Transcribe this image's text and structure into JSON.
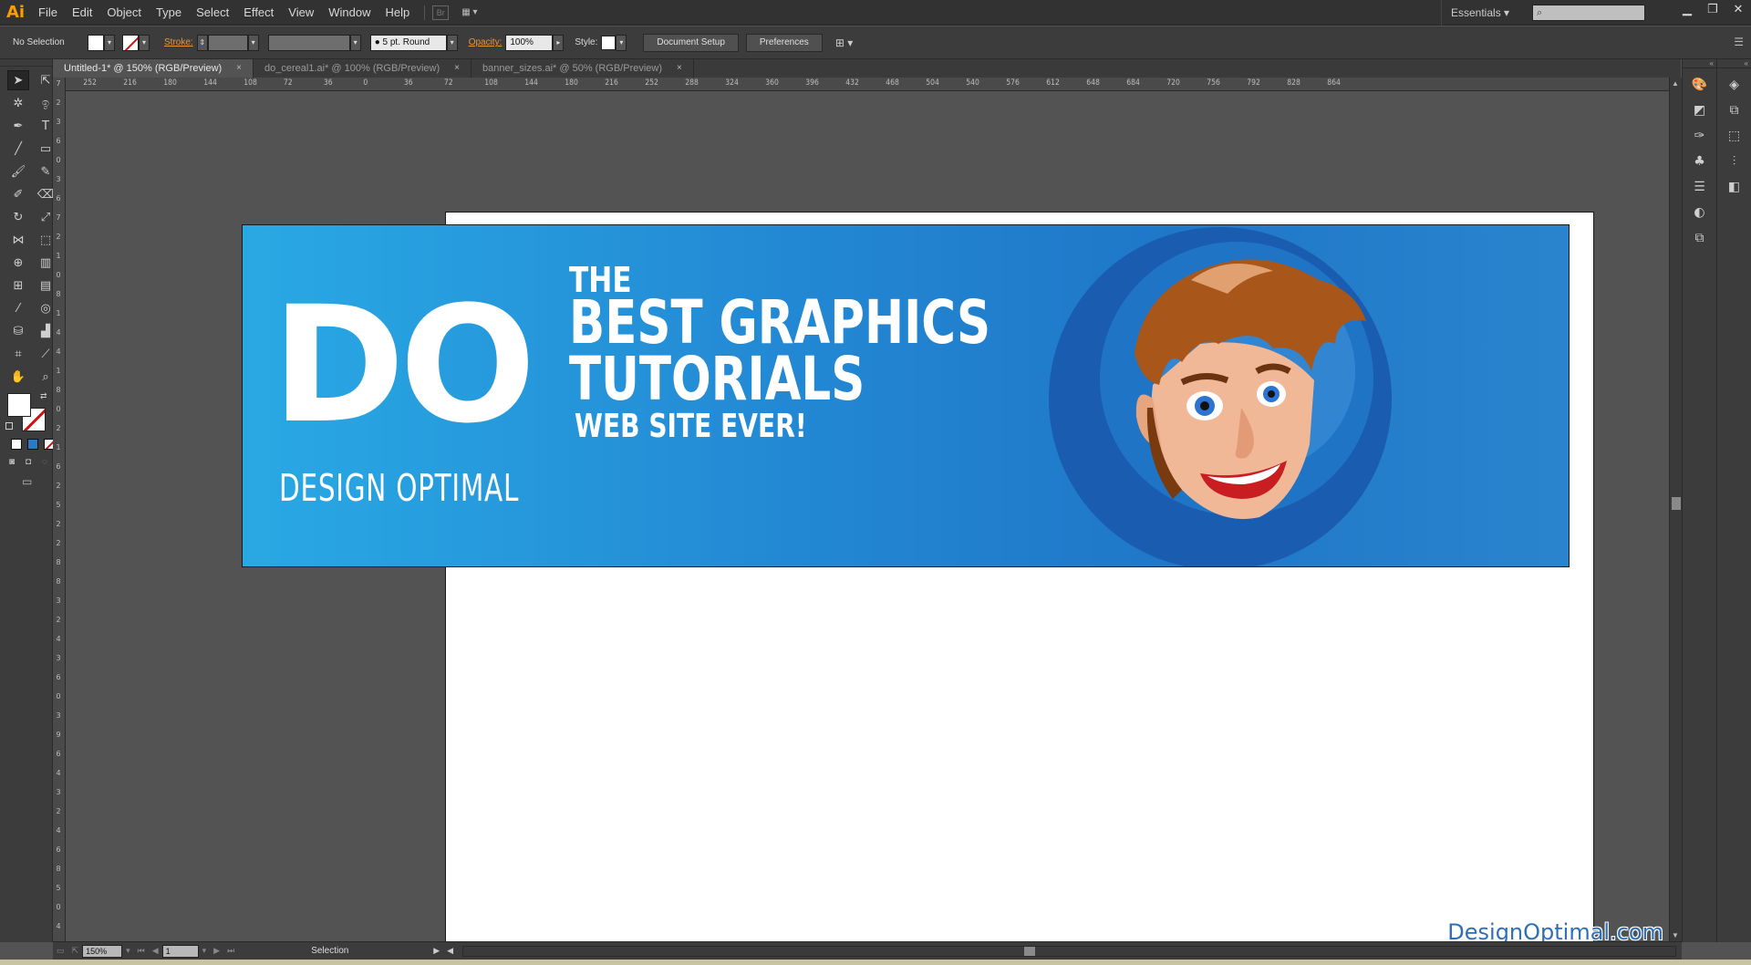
{
  "app": {
    "logo": "Ai"
  },
  "menubar": {
    "items": [
      {
        "label": "File"
      },
      {
        "label": "Edit"
      },
      {
        "label": "Object"
      },
      {
        "label": "Type"
      },
      {
        "label": "Select"
      },
      {
        "label": "Effect"
      },
      {
        "label": "View"
      },
      {
        "label": "Window"
      },
      {
        "label": "Help"
      }
    ],
    "bridge_label": "Br",
    "workspace": "Essentials",
    "search_placeholder": ""
  },
  "controlbar": {
    "selection": "No Selection",
    "stroke_label": "Stroke:",
    "brush": "5 pt. Round",
    "opacity_label": "Opacity:",
    "opacity_value": "100%",
    "style_label": "Style:",
    "document_setup": "Document Setup",
    "preferences": "Preferences"
  },
  "tabs": [
    {
      "label": "Untitled-1* @ 150% (RGB/Preview)",
      "active": true
    },
    {
      "label": "do_cereal1.ai* @ 100% (RGB/Preview)",
      "active": false
    },
    {
      "label": "banner_sizes.ai* @ 50% (RGB/Preview)",
      "active": false
    }
  ],
  "ruler": {
    "h_ticks": [
      "252",
      "216",
      "180",
      "144",
      "108",
      "72",
      "36",
      "0",
      "36",
      "72",
      "108",
      "144",
      "180",
      "216",
      "252",
      "288",
      "324",
      "360",
      "396",
      "432",
      "468",
      "504",
      "540",
      "576",
      "612",
      "648",
      "684",
      "720",
      "756",
      "792",
      "828",
      "864"
    ],
    "v_ticks": [
      "7",
      "2",
      "3",
      "6",
      "0",
      "3",
      "6",
      "7",
      "2",
      "1",
      "0",
      "8",
      "1",
      "4",
      "4",
      "1",
      "8",
      "0",
      "2",
      "1",
      "6",
      "2",
      "5",
      "2",
      "2",
      "8",
      "8",
      "3",
      "2",
      "4",
      "3",
      "6",
      "0",
      "3",
      "9",
      "6",
      "4",
      "3",
      "2",
      "4",
      "6",
      "8",
      "5",
      "0",
      "4"
    ]
  },
  "banner": {
    "do": "DO",
    "subtitle": "DESIGN OPTIMAL",
    "the": "THE",
    "line1": "BEST GRAPHICS",
    "line2": "TUTORIALS",
    "line3": "WEB SITE EVER!"
  },
  "statusbar": {
    "zoom": "150%",
    "page": "1",
    "status": "Selection"
  },
  "watermark": "DesignOptimal.com",
  "colors": {
    "accent": "#ff9a00",
    "banner_left": "#29a9e4",
    "banner_right": "#1f77c8"
  }
}
